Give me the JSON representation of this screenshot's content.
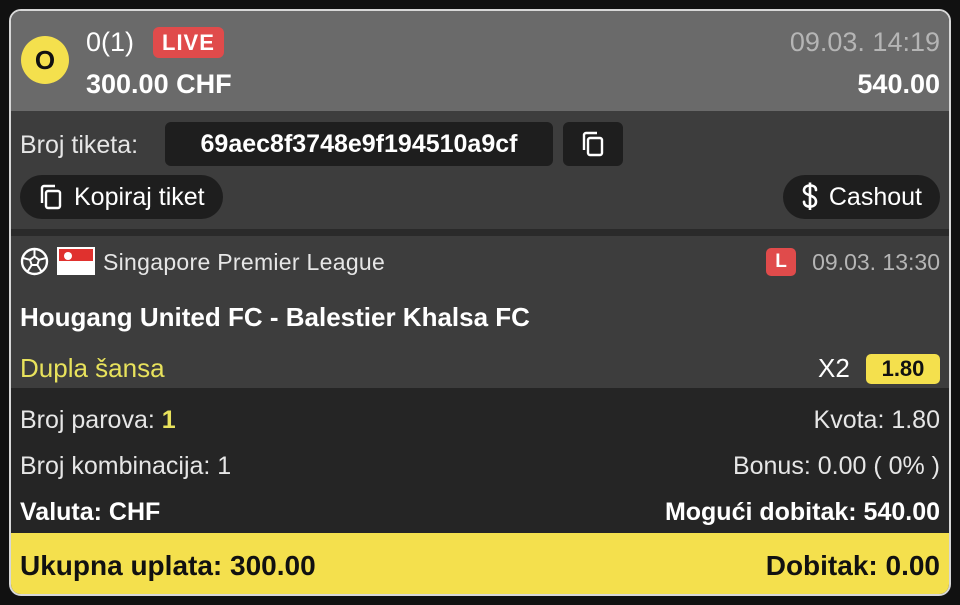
{
  "header": {
    "status_letter": "O",
    "count": "0(1)",
    "live_label": "LIVE",
    "date": "09.03. 14:19",
    "stake": "300.00 CHF",
    "payout": "540.00"
  },
  "ticket": {
    "id_label": "Broj tiketa:",
    "id_value": "69aec8f3748e9f194510a9cf",
    "copy_ticket_label": "Kopiraj tiket",
    "cashout_label": "Cashout"
  },
  "match": {
    "sport_icon": "soccer-ball-icon",
    "flag": "singapore-flag",
    "league": "Singapore Premier League",
    "live_marker": "L",
    "date": "09.03. 13:30",
    "teams": "Hougang United FC - Balestier Khalsa FC",
    "market": "Dupla šansa",
    "pick": "X2",
    "odd": "1.80"
  },
  "summary": {
    "pairs_label": "Broj parova:",
    "pairs_value": "1",
    "odds_text": "Kvota: 1.80",
    "combinations_text": "Broj kombinacija: 1",
    "bonus_text": "Bonus: 0.00 ( 0% )",
    "currency_text": "Valuta: CHF",
    "possible_win_text": "Mogući dobitak: 540.00"
  },
  "footer": {
    "total_stake_text": "Ukupna uplata: 300.00",
    "win_text": "Dobitak: 0.00"
  },
  "colors": {
    "accent_yellow": "#f4e04d",
    "live_red": "#e04b4b",
    "market_yellow": "#e8e25c"
  }
}
